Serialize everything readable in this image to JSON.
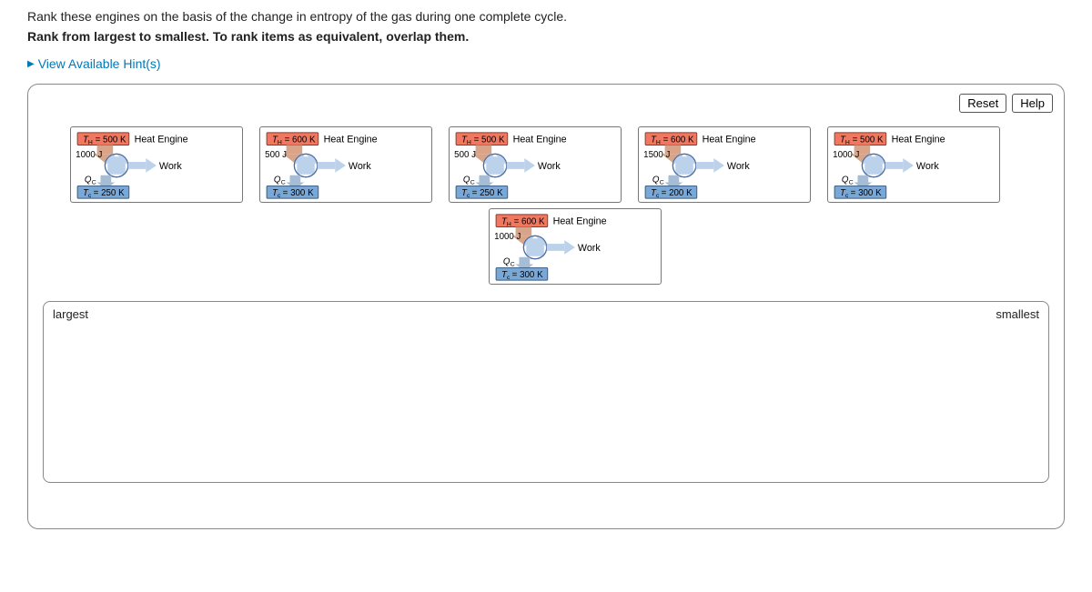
{
  "question": "Rank these engines on the basis of the change in entropy of the gas during one complete cycle.",
  "instruction": "Rank from largest to smallest. To rank items as equivalent, overlap them.",
  "hints_label": "View Available Hint(s)",
  "buttons": {
    "reset": "Reset",
    "help": "Help"
  },
  "drop": {
    "left": "largest",
    "right": "smallest"
  },
  "common": {
    "heat_engine": "Heat Engine",
    "work": "Work",
    "qc": "Q",
    "qc_sub": "C",
    "th": "T",
    "th_sub": "H",
    "tc": "T",
    "tc_sub": "c"
  },
  "engines": [
    {
      "th_val": "= 500 K",
      "qin": "1000 J",
      "tc_val": "= 250 K"
    },
    {
      "th_val": "= 600 K",
      "qin": "500 J",
      "tc_val": "= 300 K"
    },
    {
      "th_val": "= 500 K",
      "qin": "500 J",
      "tc_val": "= 250 K"
    },
    {
      "th_val": "= 600 K",
      "qin": "1500 J",
      "tc_val": "= 200 K"
    },
    {
      "th_val": "= 500 K",
      "qin": "1000 J",
      "tc_val": "= 300 K"
    },
    {
      "th_val": "= 600 K",
      "qin": "1000 J",
      "tc_val": "= 300 K"
    }
  ],
  "chart_data": {
    "type": "table",
    "title": "Heat engine parameters for entropy ranking",
    "columns": [
      "T_H (K)",
      "Q_in (J)",
      "T_c (K)"
    ],
    "rows": [
      [
        500,
        1000,
        250
      ],
      [
        600,
        500,
        300
      ],
      [
        500,
        500,
        250
      ],
      [
        600,
        1500,
        200
      ],
      [
        500,
        1000,
        300
      ],
      [
        600,
        1000,
        300
      ]
    ]
  }
}
